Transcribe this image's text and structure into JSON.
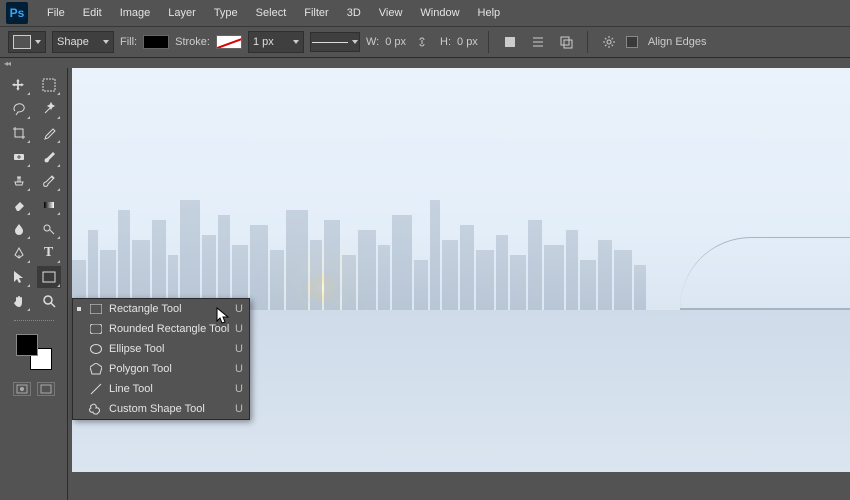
{
  "app": {
    "logo": "Ps"
  },
  "menu": [
    "File",
    "Edit",
    "Image",
    "Layer",
    "Type",
    "Select",
    "Filter",
    "3D",
    "View",
    "Window",
    "Help"
  ],
  "options": {
    "mode": "Shape",
    "fill_label": "Fill:",
    "stroke_label": "Stroke:",
    "stroke_width": "1 px",
    "w_label": "W:",
    "w_value": "0 px",
    "h_label": "H:",
    "h_value": "0 px",
    "align_edges": "Align Edges"
  },
  "flyout": {
    "items": [
      {
        "label": "Rectangle Tool",
        "key": "U",
        "icon": "rect",
        "selected": true
      },
      {
        "label": "Rounded Rectangle Tool",
        "key": "U",
        "icon": "rrect",
        "selected": false
      },
      {
        "label": "Ellipse Tool",
        "key": "U",
        "icon": "ellipse",
        "selected": false
      },
      {
        "label": "Polygon Tool",
        "key": "U",
        "icon": "polygon",
        "selected": false
      },
      {
        "label": "Line Tool",
        "key": "U",
        "icon": "line",
        "selected": false
      },
      {
        "label": "Custom Shape Tool",
        "key": "U",
        "icon": "blob",
        "selected": false
      }
    ]
  }
}
